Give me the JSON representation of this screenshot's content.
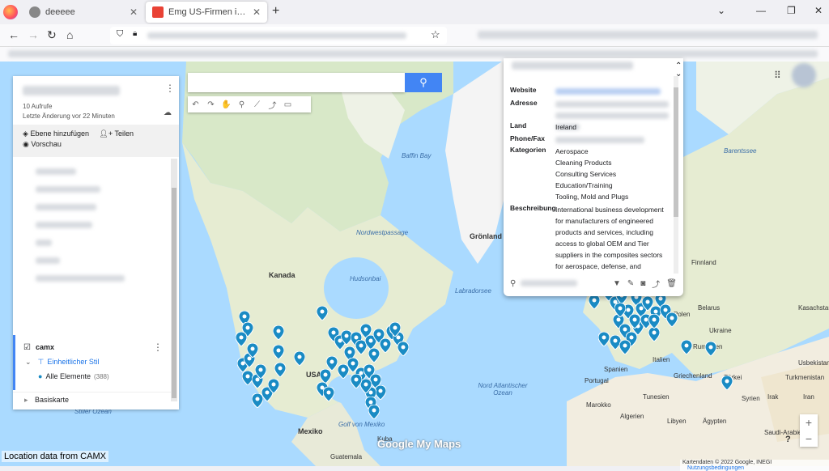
{
  "browser": {
    "tabs": [
      {
        "label": "deeeee",
        "active": false
      },
      {
        "label": "Emg US-Firmen in US – Google My Maps",
        "active": true
      }
    ]
  },
  "panel": {
    "views": "10 Aufrufe",
    "last_change": "Letzte Änderung vor 22 Minuten",
    "add_layer": "Ebene hinzufügen",
    "share": "Teilen",
    "preview": "Vorschau",
    "layer_name": "camx",
    "style": "Einheitlicher Stil",
    "all_items": "Alle Elemente",
    "count": "(388)",
    "basemap": "Basiskarte"
  },
  "info": {
    "labels": {
      "website": "Website",
      "address": "Adresse",
      "country": "Land",
      "phone": "Phone/Fax",
      "categories": "Kategorien",
      "description": "Beschreibung"
    },
    "country": "Ireland",
    "categories": [
      "Aerospace",
      "Cleaning Products",
      "Consulting Services",
      "Education/Training",
      "Tooling, Mold and Plugs"
    ],
    "description": "International business development for manufacturers of engineered products and services, including access to global OEM and Tier suppliers in the composites sectors for aerospace, defense, and"
  },
  "map": {
    "labels": {
      "baffin": "Baffin Bay",
      "greenland": "Grönland",
      "nwpassage": "Nordwestpassage",
      "hudson": "Hudsonbai",
      "kanada": "Kanada",
      "labrador": "Labradorsee",
      "usa": "USA",
      "mexiko": "Mexiko",
      "golf": "Golf von Mexiko",
      "kuba": "Kuba",
      "guatemala": "Guatemala",
      "atlantic": "Nord Atlantischer Ozean",
      "pacific": "Stiller Ozean",
      "barents": "Barentssee",
      "finnland": "Finnland",
      "polen": "Polen",
      "belarus": "Belarus",
      "ukraine": "Ukraine",
      "rumaenien": "Rumänien",
      "italien": "Italien",
      "spanien": "Spanien",
      "portugal": "Portugal",
      "griechenland": "Griechenland",
      "tuerkei": "Türkei",
      "turkmenistan": "Turkmenistan",
      "tunesien": "Tunesien",
      "libyen": "Libyen",
      "aegypten": "Ägypten",
      "syrien": "Syrien",
      "irak": "Irak",
      "iran": "Iran",
      "saudi": "Saudi-Arabien",
      "marokko": "Marokko",
      "algerien": "Algerien",
      "kasachstan": "Kasachstan",
      "usbekistan": "Usbekistan"
    },
    "attribution": "Location data from CAMX",
    "copyright": "Kartendaten © 2022 Google, INEGI",
    "terms": "Nutzungsbedingungen",
    "logo": "Google My Maps",
    "pin_color": "#1a8bc4"
  }
}
